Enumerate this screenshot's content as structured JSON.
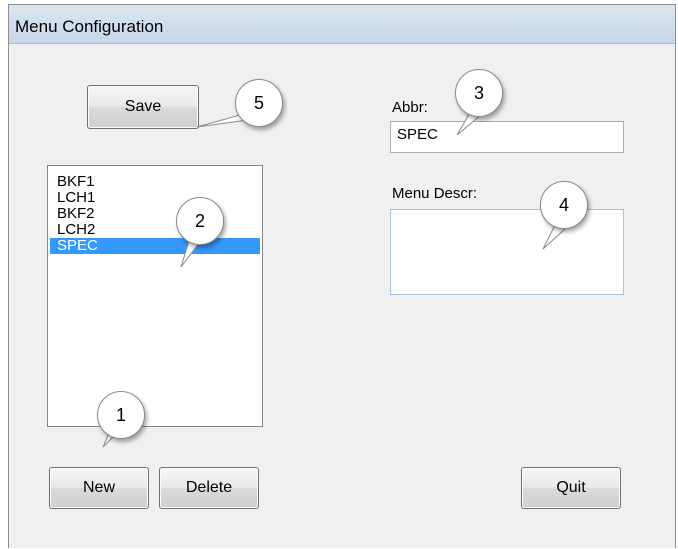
{
  "window": {
    "title": "Menu Configuration"
  },
  "buttons": {
    "save": "Save",
    "new": "New",
    "delete": "Delete",
    "quit": "Quit"
  },
  "menu_list": {
    "items": [
      "BKF1",
      "LCH1",
      "BKF2",
      "LCH2",
      "SPEC"
    ],
    "selected": "SPEC"
  },
  "abbr": {
    "label": "Abbr:",
    "value": "SPEC"
  },
  "descr": {
    "label": "Menu Descr:",
    "value": ""
  },
  "callouts": [
    "1",
    "2",
    "3",
    "4",
    "5"
  ],
  "colors": {
    "selection": "#3399ff",
    "titlebar": "#c6d6e8",
    "window": "#f0f0f0"
  }
}
